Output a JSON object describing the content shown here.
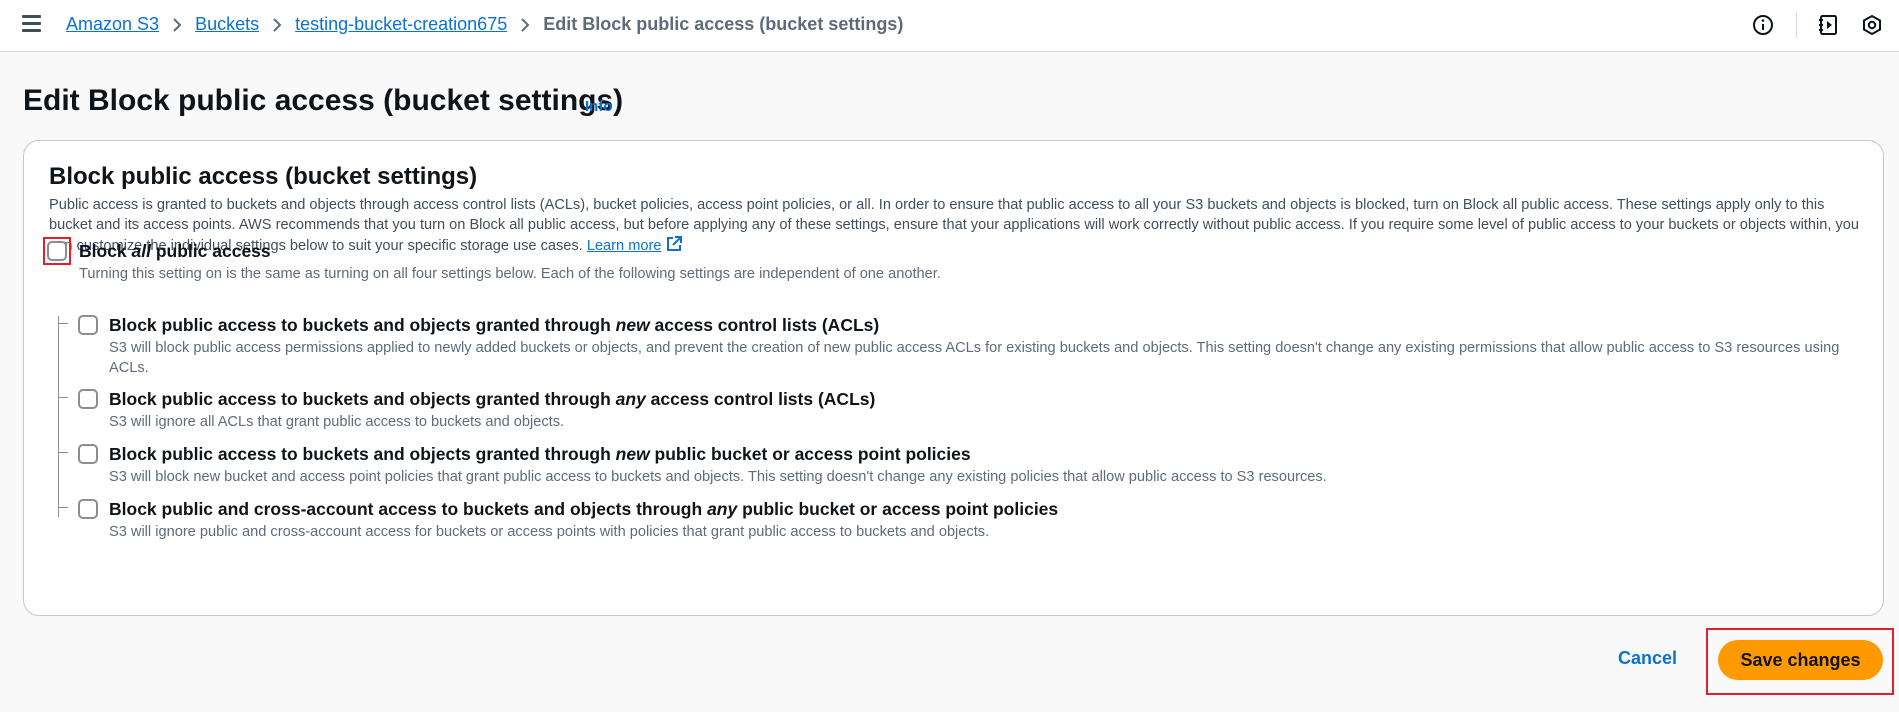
{
  "breadcrumbs": {
    "items": [
      {
        "label": "Amazon S3"
      },
      {
        "label": "Buckets"
      },
      {
        "label": "testing-bucket-creation675"
      }
    ],
    "current": "Edit Block public access (bucket settings)"
  },
  "top_icons": [
    "info-circle-icon",
    "notebook-icon",
    "settings-hex-icon"
  ],
  "page": {
    "title": "Edit Block public access (bucket settings)",
    "info_link": "Info"
  },
  "panel": {
    "title": "Block public access (bucket settings)",
    "description": "Public access is granted to buckets and objects through access control lists (ACLs), bucket policies, access point policies, or all. In order to ensure that public access to all your S3 buckets and objects is blocked, turn on Block all public access. These settings apply only to this bucket and its access points. AWS recommends that you turn on Block all public access, but before applying any of these settings, ensure that your applications will work correctly without public access. If you require some level of public access to your buckets or objects within, you can customize the individual settings below to suit your specific storage use cases.",
    "learn_more": "Learn more",
    "block_all": {
      "label_pre": "Block ",
      "label_em": "all",
      "label_post": " public access",
      "description": "Turning this setting on is the same as turning on all four settings below. Each of the following settings are independent of one another.",
      "checked": false
    },
    "options": [
      {
        "label_pre": "Block public access to buckets and objects granted through ",
        "label_em": "new",
        "label_post": " access control lists (ACLs)",
        "description": "S3 will block public access permissions applied to newly added buckets or objects, and prevent the creation of new public access ACLs for existing buckets and objects. This setting doesn't change any existing permissions that allow public access to S3 resources using ACLs.",
        "checked": false
      },
      {
        "label_pre": "Block public access to buckets and objects granted through ",
        "label_em": "any",
        "label_post": " access control lists (ACLs)",
        "description": "S3 will ignore all ACLs that grant public access to buckets and objects.",
        "checked": false
      },
      {
        "label_pre": "Block public access to buckets and objects granted through ",
        "label_em": "new",
        "label_post": " public bucket or access point policies",
        "description": "S3 will block new bucket and access point policies that grant public access to buckets and objects. This setting doesn't change any existing policies that allow public access to S3 resources.",
        "checked": false
      },
      {
        "label_pre": "Block public and cross-account access to buckets and objects through ",
        "label_em": "any",
        "label_post": " public bucket or access point policies",
        "description": "S3 will ignore public and cross-account access for buckets or access points with policies that grant public access to buckets and objects.",
        "checked": false
      }
    ]
  },
  "actions": {
    "cancel": "Cancel",
    "save": "Save changes"
  },
  "colors": {
    "link": "#0972d3",
    "primary_button": "#ff9900",
    "highlight": "#e0212b"
  }
}
